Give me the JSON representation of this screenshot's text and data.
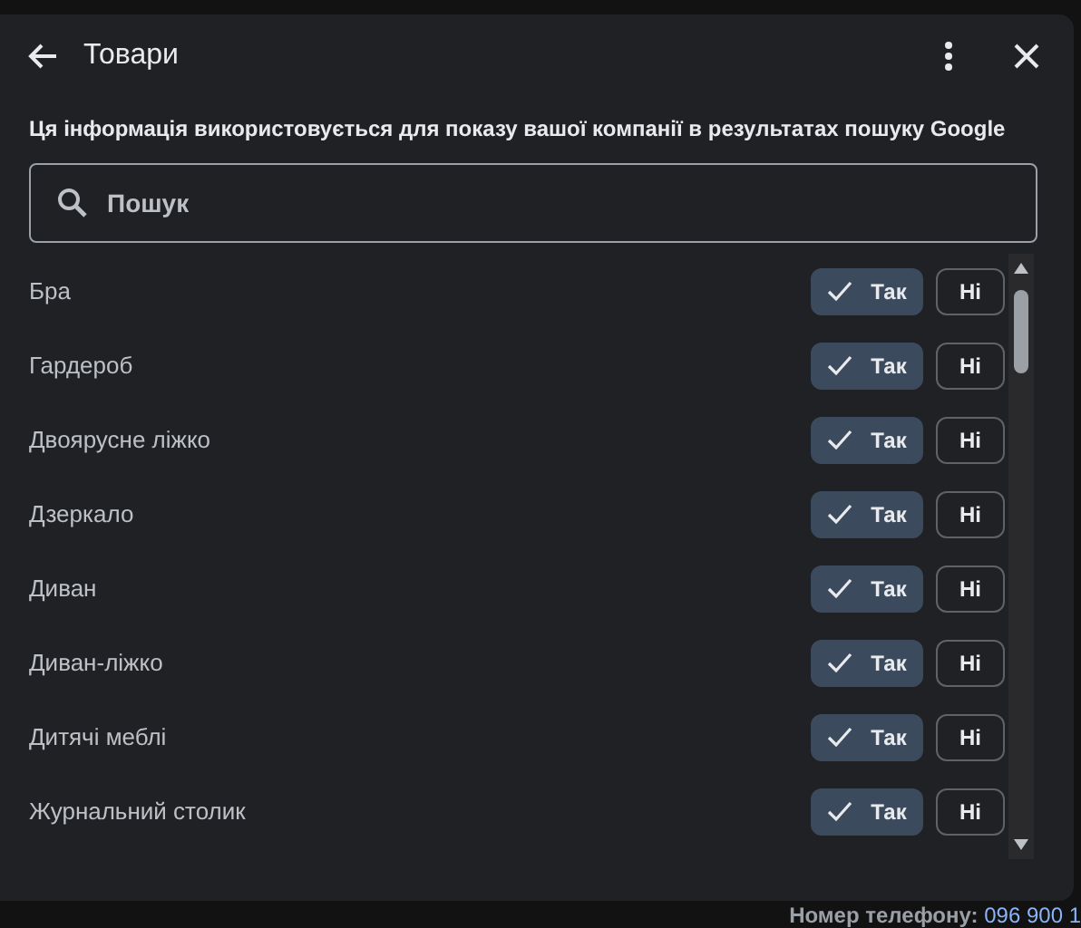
{
  "dialog": {
    "title": "Товари",
    "description": "Ця інформація використовується для показу вашої компанії в результатах пошуку Google",
    "search": {
      "placeholder": "Пошук"
    },
    "items": [
      {
        "name": "Бра",
        "options": [
          {
            "label": "Так",
            "selected": true
          },
          {
            "label": "Ні",
            "selected": false
          }
        ]
      },
      {
        "name": "Гардероб",
        "options": [
          {
            "label": "Так",
            "selected": true
          },
          {
            "label": "Ні",
            "selected": false
          }
        ]
      },
      {
        "name": "Двоярусне ліжко",
        "options": [
          {
            "label": "Так",
            "selected": true
          },
          {
            "label": "Ні",
            "selected": false
          }
        ]
      },
      {
        "name": "Дзеркало",
        "options": [
          {
            "label": "Так",
            "selected": true
          },
          {
            "label": "Ні",
            "selected": false
          }
        ]
      },
      {
        "name": "Диван",
        "options": [
          {
            "label": "Так",
            "selected": true
          },
          {
            "label": "Ні",
            "selected": false
          }
        ]
      },
      {
        "name": "Диван-ліжко",
        "options": [
          {
            "label": "Так",
            "selected": true
          },
          {
            "label": "Ні",
            "selected": false
          }
        ]
      },
      {
        "name": "Дитячі меблі",
        "options": [
          {
            "label": "Так",
            "selected": true
          },
          {
            "label": "Ні",
            "selected": false
          }
        ]
      },
      {
        "name": "Журнальний столик",
        "options": [
          {
            "label": "Так",
            "selected": true
          },
          {
            "label": "Ні",
            "selected": false
          }
        ]
      }
    ]
  },
  "background": {
    "phone_label": "Номер телефону:",
    "phone_value": "096 900 1"
  }
}
